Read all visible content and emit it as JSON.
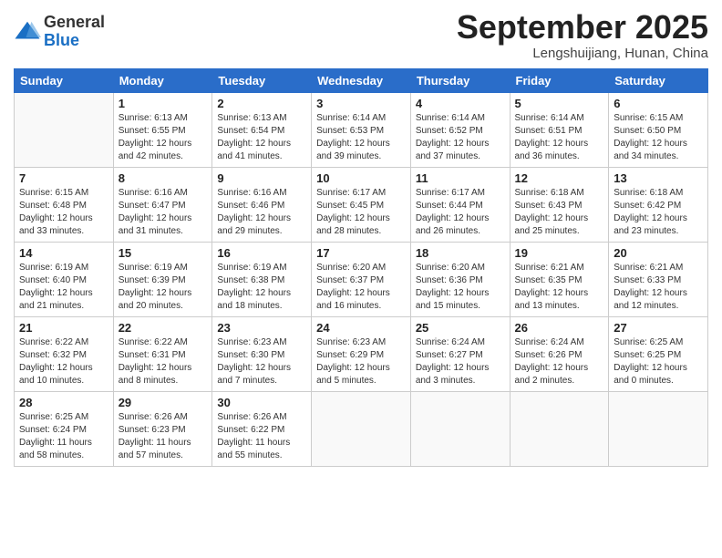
{
  "header": {
    "logo": {
      "general": "General",
      "blue": "Blue"
    },
    "title": "September 2025",
    "location": "Lengshuijiang, Hunan, China"
  },
  "days_of_week": [
    "Sunday",
    "Monday",
    "Tuesday",
    "Wednesday",
    "Thursday",
    "Friday",
    "Saturday"
  ],
  "weeks": [
    [
      {
        "day": "",
        "content": ""
      },
      {
        "day": "1",
        "content": "Sunrise: 6:13 AM\nSunset: 6:55 PM\nDaylight: 12 hours\nand 42 minutes."
      },
      {
        "day": "2",
        "content": "Sunrise: 6:13 AM\nSunset: 6:54 PM\nDaylight: 12 hours\nand 41 minutes."
      },
      {
        "day": "3",
        "content": "Sunrise: 6:14 AM\nSunset: 6:53 PM\nDaylight: 12 hours\nand 39 minutes."
      },
      {
        "day": "4",
        "content": "Sunrise: 6:14 AM\nSunset: 6:52 PM\nDaylight: 12 hours\nand 37 minutes."
      },
      {
        "day": "5",
        "content": "Sunrise: 6:14 AM\nSunset: 6:51 PM\nDaylight: 12 hours\nand 36 minutes."
      },
      {
        "day": "6",
        "content": "Sunrise: 6:15 AM\nSunset: 6:50 PM\nDaylight: 12 hours\nand 34 minutes."
      }
    ],
    [
      {
        "day": "7",
        "content": "Sunrise: 6:15 AM\nSunset: 6:48 PM\nDaylight: 12 hours\nand 33 minutes."
      },
      {
        "day": "8",
        "content": "Sunrise: 6:16 AM\nSunset: 6:47 PM\nDaylight: 12 hours\nand 31 minutes."
      },
      {
        "day": "9",
        "content": "Sunrise: 6:16 AM\nSunset: 6:46 PM\nDaylight: 12 hours\nand 29 minutes."
      },
      {
        "day": "10",
        "content": "Sunrise: 6:17 AM\nSunset: 6:45 PM\nDaylight: 12 hours\nand 28 minutes."
      },
      {
        "day": "11",
        "content": "Sunrise: 6:17 AM\nSunset: 6:44 PM\nDaylight: 12 hours\nand 26 minutes."
      },
      {
        "day": "12",
        "content": "Sunrise: 6:18 AM\nSunset: 6:43 PM\nDaylight: 12 hours\nand 25 minutes."
      },
      {
        "day": "13",
        "content": "Sunrise: 6:18 AM\nSunset: 6:42 PM\nDaylight: 12 hours\nand 23 minutes."
      }
    ],
    [
      {
        "day": "14",
        "content": "Sunrise: 6:19 AM\nSunset: 6:40 PM\nDaylight: 12 hours\nand 21 minutes."
      },
      {
        "day": "15",
        "content": "Sunrise: 6:19 AM\nSunset: 6:39 PM\nDaylight: 12 hours\nand 20 minutes."
      },
      {
        "day": "16",
        "content": "Sunrise: 6:19 AM\nSunset: 6:38 PM\nDaylight: 12 hours\nand 18 minutes."
      },
      {
        "day": "17",
        "content": "Sunrise: 6:20 AM\nSunset: 6:37 PM\nDaylight: 12 hours\nand 16 minutes."
      },
      {
        "day": "18",
        "content": "Sunrise: 6:20 AM\nSunset: 6:36 PM\nDaylight: 12 hours\nand 15 minutes."
      },
      {
        "day": "19",
        "content": "Sunrise: 6:21 AM\nSunset: 6:35 PM\nDaylight: 12 hours\nand 13 minutes."
      },
      {
        "day": "20",
        "content": "Sunrise: 6:21 AM\nSunset: 6:33 PM\nDaylight: 12 hours\nand 12 minutes."
      }
    ],
    [
      {
        "day": "21",
        "content": "Sunrise: 6:22 AM\nSunset: 6:32 PM\nDaylight: 12 hours\nand 10 minutes."
      },
      {
        "day": "22",
        "content": "Sunrise: 6:22 AM\nSunset: 6:31 PM\nDaylight: 12 hours\nand 8 minutes."
      },
      {
        "day": "23",
        "content": "Sunrise: 6:23 AM\nSunset: 6:30 PM\nDaylight: 12 hours\nand 7 minutes."
      },
      {
        "day": "24",
        "content": "Sunrise: 6:23 AM\nSunset: 6:29 PM\nDaylight: 12 hours\nand 5 minutes."
      },
      {
        "day": "25",
        "content": "Sunrise: 6:24 AM\nSunset: 6:27 PM\nDaylight: 12 hours\nand 3 minutes."
      },
      {
        "day": "26",
        "content": "Sunrise: 6:24 AM\nSunset: 6:26 PM\nDaylight: 12 hours\nand 2 minutes."
      },
      {
        "day": "27",
        "content": "Sunrise: 6:25 AM\nSunset: 6:25 PM\nDaylight: 12 hours\nand 0 minutes."
      }
    ],
    [
      {
        "day": "28",
        "content": "Sunrise: 6:25 AM\nSunset: 6:24 PM\nDaylight: 11 hours\nand 58 minutes."
      },
      {
        "day": "29",
        "content": "Sunrise: 6:26 AM\nSunset: 6:23 PM\nDaylight: 11 hours\nand 57 minutes."
      },
      {
        "day": "30",
        "content": "Sunrise: 6:26 AM\nSunset: 6:22 PM\nDaylight: 11 hours\nand 55 minutes."
      },
      {
        "day": "",
        "content": ""
      },
      {
        "day": "",
        "content": ""
      },
      {
        "day": "",
        "content": ""
      },
      {
        "day": "",
        "content": ""
      }
    ]
  ]
}
